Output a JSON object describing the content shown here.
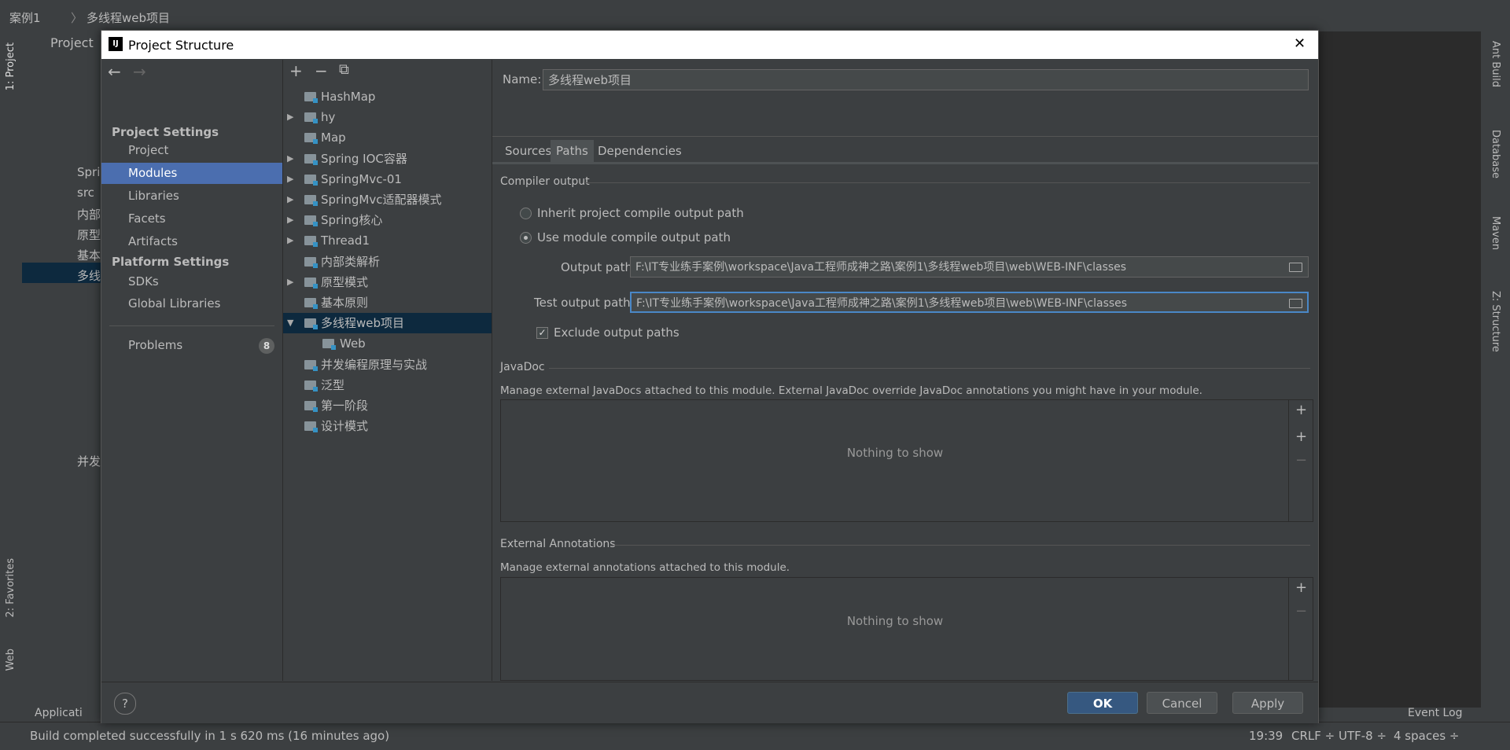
{
  "ide": {
    "breadcrumb": [
      "案例1",
      "多线程web项目"
    ],
    "project_tab": "Project",
    "left_tools": [
      "1: Project",
      "2: Favorites",
      "Web"
    ],
    "right_tools": [
      "Ant Build",
      "Database",
      "Maven",
      "Z: Structure"
    ],
    "status": {
      "message": "Build completed successfully in 1 s 620 ms (16 minutes ago)",
      "time": "19:39",
      "line_sep": "CRLF ÷",
      "encoding": "UTF-8 ÷",
      "indent": "4 spaces ÷",
      "event_log": "Event Log",
      "app_tab": "Applicati"
    },
    "bg_tree": [
      "Spri",
      "src",
      "内部",
      "原型",
      "基本",
      "多线",
      "并发"
    ]
  },
  "dialog": {
    "title": "Project Structure",
    "close": "✕",
    "nav": {
      "back": "←",
      "forward": "→",
      "project_settings": "Project Settings",
      "items_ps": [
        "Project",
        "Modules",
        "Libraries",
        "Facets",
        "Artifacts"
      ],
      "platform_settings": "Platform Settings",
      "items_pl": [
        "SDKs",
        "Global Libraries"
      ],
      "problems": "Problems",
      "problems_count": "8"
    },
    "tree_toolbar": {
      "add": "+",
      "remove": "−",
      "copy": "⧉"
    },
    "modules": [
      {
        "label": "HashMap",
        "arrow": ""
      },
      {
        "label": "hy",
        "arrow": "▶"
      },
      {
        "label": "Map",
        "arrow": ""
      },
      {
        "label": "Spring IOC容器",
        "arrow": "▶"
      },
      {
        "label": "SpringMvc-01",
        "arrow": "▶"
      },
      {
        "label": "SpringMvc适配器模式",
        "arrow": "▶"
      },
      {
        "label": "Spring核心",
        "arrow": "▶"
      },
      {
        "label": "Thread1",
        "arrow": "▶"
      },
      {
        "label": "内部类解析",
        "arrow": ""
      },
      {
        "label": "原型模式",
        "arrow": "▶"
      },
      {
        "label": "基本原则",
        "arrow": ""
      },
      {
        "label": "多线程web项目",
        "arrow": "▼"
      },
      {
        "label": "Web",
        "arrow": ""
      },
      {
        "label": "并发编程原理与实战",
        "arrow": ""
      },
      {
        "label": "泛型",
        "arrow": ""
      },
      {
        "label": "第一阶段",
        "arrow": ""
      },
      {
        "label": "设计模式",
        "arrow": ""
      }
    ],
    "name_label": "Name:",
    "name_value": "多线程web项目",
    "tabs": [
      "Sources",
      "Paths",
      "Dependencies"
    ],
    "compiler_output": "Compiler output",
    "inherit_label": "Inherit project compile output path",
    "use_module_label": "Use module compile output path",
    "output_path_label": "Output path:",
    "output_path": "F:\\IT专业练手案例\\workspace\\Java工程师成神之路\\案例1\\多线程web项目\\web\\WEB-INF\\classes",
    "test_output_label": "Test output path:",
    "test_output_path": "F:\\IT专业练手案例\\workspace\\Java工程师成神之路\\案例1\\多线程web项目\\web\\WEB-INF\\classes",
    "exclude_label": "Exclude output paths",
    "javadoc": "JavaDoc",
    "javadoc_desc": "Manage external JavaDocs attached to this module. External JavaDoc override JavaDoc annotations you might have in your module.",
    "nothing": "Nothing to show",
    "ext_annotations": "External Annotations",
    "ext_desc": "Manage external annotations attached to this module.",
    "help": "?",
    "ok": "OK",
    "cancel": "Cancel",
    "apply": "Apply"
  }
}
